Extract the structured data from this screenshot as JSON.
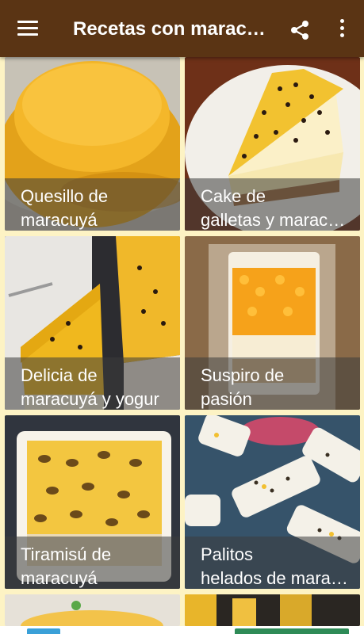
{
  "app_bar": {
    "title": "Recetas con maracuyá",
    "menu_icon": "hamburger-menu-icon",
    "share_icon": "share-icon",
    "more_icon": "more-vert-icon",
    "background_color": "#5a3414"
  },
  "recipes": [
    {
      "title": "Quesillo de\nmaracuyá"
    },
    {
      "title": "Cake de\ngalletas y  maracuyá"
    },
    {
      "title": "Delicia de\nmaracuyá y yogur"
    },
    {
      "title": "Suspiro de\npasión"
    },
    {
      "title": "Tiramisú de\nmaracuyá"
    },
    {
      "title": "Palitos\nhelados de maracuyá"
    }
  ]
}
